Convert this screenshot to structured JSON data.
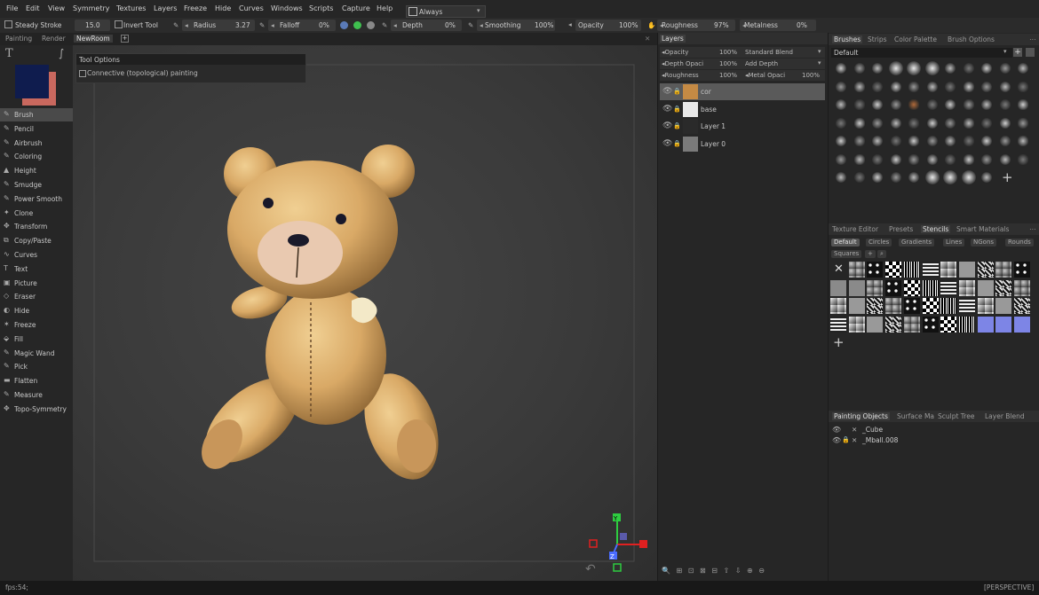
{
  "menu": [
    "File",
    "Edit",
    "View",
    "Symmetry",
    "Textures",
    "Layers",
    "Freeze",
    "Hide",
    "Curves",
    "Windows",
    "Scripts",
    "Capture",
    "Help"
  ],
  "always_select": "Always",
  "toolbar": {
    "steady_stroke": "Steady Stroke",
    "steady_value": "15.0",
    "invert_tool": "Invert Tool",
    "radius": "Radius",
    "radius_value": "3.27",
    "falloff": "Falloff",
    "falloff_value": "0%",
    "depth": "Depth",
    "depth_value": "0%",
    "smoothing": "Smoothing",
    "smoothing_value": "100%",
    "opacity": "Opacity",
    "opacity_value": "100%",
    "roughness": "Roughness",
    "roughness_value": "97%",
    "metalness": "Metalness",
    "metalness_value": "0%"
  },
  "room_tabs": [
    "Painting",
    "Render",
    "NewRoom"
  ],
  "tools": [
    "Brush",
    "Pencil",
    "Airbrush",
    "Coloring",
    "Height",
    "Smudge",
    "Power Smooth",
    "Clone",
    "Transform",
    "Copy/Paste",
    "Curves",
    "Text",
    "Picture",
    "Eraser",
    "Hide",
    "Freeze",
    "Fill",
    "Magic Wand",
    "Pick",
    "Flatten",
    "Measure",
    "Topo-Symmetry"
  ],
  "colors": {
    "primary": "#0f1c4e",
    "secondary": "#c9685e",
    "accent_active": "#4a4a4a"
  },
  "tool_options": {
    "title": "Tool Options",
    "connective": "Connective (topological) painting"
  },
  "layers": {
    "title": "Layers",
    "props": [
      {
        "label": "Opacity",
        "value": "100%",
        "blend": "Standard Blend"
      },
      {
        "label": "Depth Opaci",
        "value": "100%",
        "blend": "Add Depth"
      },
      {
        "label": "Roughness",
        "value": "100%",
        "blend": "Metal Opaci",
        "blend_value": "100%"
      }
    ],
    "items": [
      "cor",
      "base",
      "Layer 1",
      "Layer 0"
    ]
  },
  "brushes": {
    "tabs": [
      "Brushes",
      "Strips",
      "Color Palette",
      "Brush Options"
    ],
    "preset": "Default"
  },
  "stencils": {
    "tabs": [
      "Texture Editor",
      "Presets",
      "Stencils",
      "Smart Materials"
    ],
    "chips": [
      "Default",
      "Circles",
      "Gradients",
      "Lines",
      "NGons",
      "Rounds",
      "Squares"
    ]
  },
  "objects": {
    "tabs": [
      "Painting Objects",
      "Surface Ma",
      "Sculpt Tree",
      "Layer Blend"
    ],
    "items": [
      "_Cube",
      "_Mball.008"
    ]
  },
  "status": {
    "fps": "fps:54;",
    "view": "[PERSPECTIVE]"
  },
  "gizmo": {
    "y": "Y",
    "z": "Z"
  }
}
